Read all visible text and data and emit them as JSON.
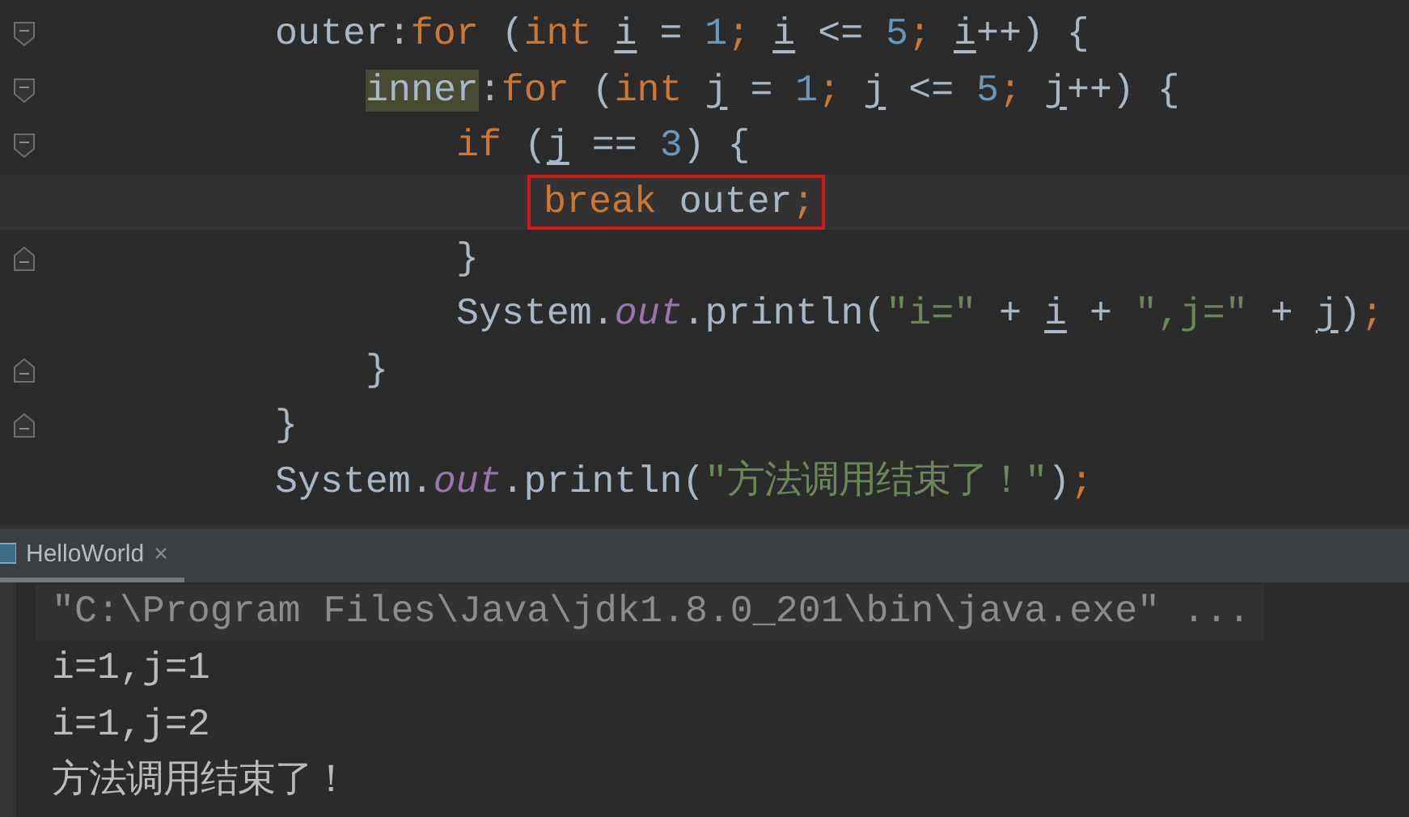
{
  "editor": {
    "lines": [
      {
        "fold_open": true,
        "tokens": [
          {
            "t": "outer:"
          },
          {
            "t": "for",
            "color": "#cc7832"
          },
          {
            "t": " ("
          },
          {
            "t": "int ",
            "color": "#cc7832"
          },
          {
            "t": "i",
            "underline": true
          },
          {
            "t": " = "
          },
          {
            "t": "1",
            "color": "#6897bb"
          },
          {
            "t": "; ",
            "color": "#cc7832"
          },
          {
            "t": "i",
            "underline": true
          },
          {
            "t": " <= "
          },
          {
            "t": "5",
            "color": "#6897bb"
          },
          {
            "t": "; ",
            "color": "#cc7832"
          },
          {
            "t": "i",
            "underline": true
          },
          {
            "t": "++) {"
          }
        ],
        "children": [
          {
            "fold_open": true,
            "tokens": [
              {
                "t": "inner",
                "highlight": true
              },
              {
                "t": ":"
              },
              {
                "t": "for",
                "color": "#cc7832"
              },
              {
                "t": " ("
              },
              {
                "t": "int ",
                "color": "#cc7832"
              },
              {
                "t": "j",
                "underline": true
              },
              {
                "t": " = "
              },
              {
                "t": "1",
                "color": "#6897bb"
              },
              {
                "t": "; ",
                "color": "#cc7832"
              },
              {
                "t": "j",
                "underline": true
              },
              {
                "t": " <= "
              },
              {
                "t": "5",
                "color": "#6897bb"
              },
              {
                "t": "; ",
                "color": "#cc7832"
              },
              {
                "t": "j",
                "underline": true
              },
              {
                "t": "++) {"
              }
            ],
            "children": [
              {
                "fold_open": true,
                "tokens": [
                  {
                    "t": "if",
                    "color": "#cc7832"
                  },
                  {
                    "t": " ("
                  },
                  {
                    "t": "j",
                    "underline": true
                  },
                  {
                    "t": " == "
                  },
                  {
                    "t": "3",
                    "color": "#6897bb"
                  },
                  {
                    "t": ") {"
                  }
                ],
                "children": [
                  {
                    "current": true,
                    "boxed": true,
                    "tokens": [
                      {
                        "t": "break",
                        "color": "#cc7832"
                      },
                      {
                        "t": " outer"
                      },
                      {
                        "t": ";",
                        "color": "#cc7832"
                      }
                    ]
                  }
                ]
              },
              {
                "fold_close": true,
                "tokens": [
                  {
                    "t": "}"
                  }
                ]
              },
              {
                "tokens": [
                  {
                    "t": "System."
                  },
                  {
                    "t": "out",
                    "color": "#9876aa",
                    "italic": true
                  },
                  {
                    "t": ".println("
                  },
                  {
                    "t": "\"i=\"",
                    "color": "#6a8759"
                  },
                  {
                    "t": " + "
                  },
                  {
                    "t": "i",
                    "underline": true
                  },
                  {
                    "t": " + "
                  },
                  {
                    "t": "\",j=\"",
                    "color": "#6a8759"
                  },
                  {
                    "t": " + "
                  },
                  {
                    "t": "j",
                    "underline": true
                  },
                  {
                    "t": ")"
                  },
                  {
                    "t": ";",
                    "color": "#cc7832"
                  }
                ]
              }
            ]
          },
          {
            "fold_close": true,
            "tokens": [
              {
                "t": "}"
              }
            ]
          }
        ]
      },
      {
        "fold_close": true,
        "tokens": [
          {
            "t": "}"
          }
        ]
      },
      {
        "tokens": [
          {
            "t": "System."
          },
          {
            "t": "out",
            "color": "#9876aa",
            "italic": true
          },
          {
            "t": ".println("
          },
          {
            "t": "\"方法调用结束了！\"",
            "color": "#6a8759"
          },
          {
            "t": ")"
          },
          {
            "t": ";",
            "color": "#cc7832"
          }
        ]
      }
    ]
  },
  "console": {
    "tabs": [
      {
        "label": "HelloWorld",
        "close": "×",
        "selected": true
      }
    ],
    "lines": [
      {
        "kind": "command",
        "text": "\"C:\\Program Files\\Java\\jdk1.8.0_201\\bin\\java.exe\" ..."
      },
      {
        "kind": "output",
        "text": "i=1,j=1"
      },
      {
        "kind": "output",
        "text": "i=1,j=2"
      },
      {
        "kind": "output",
        "text": "方法调用结束了！"
      }
    ]
  }
}
